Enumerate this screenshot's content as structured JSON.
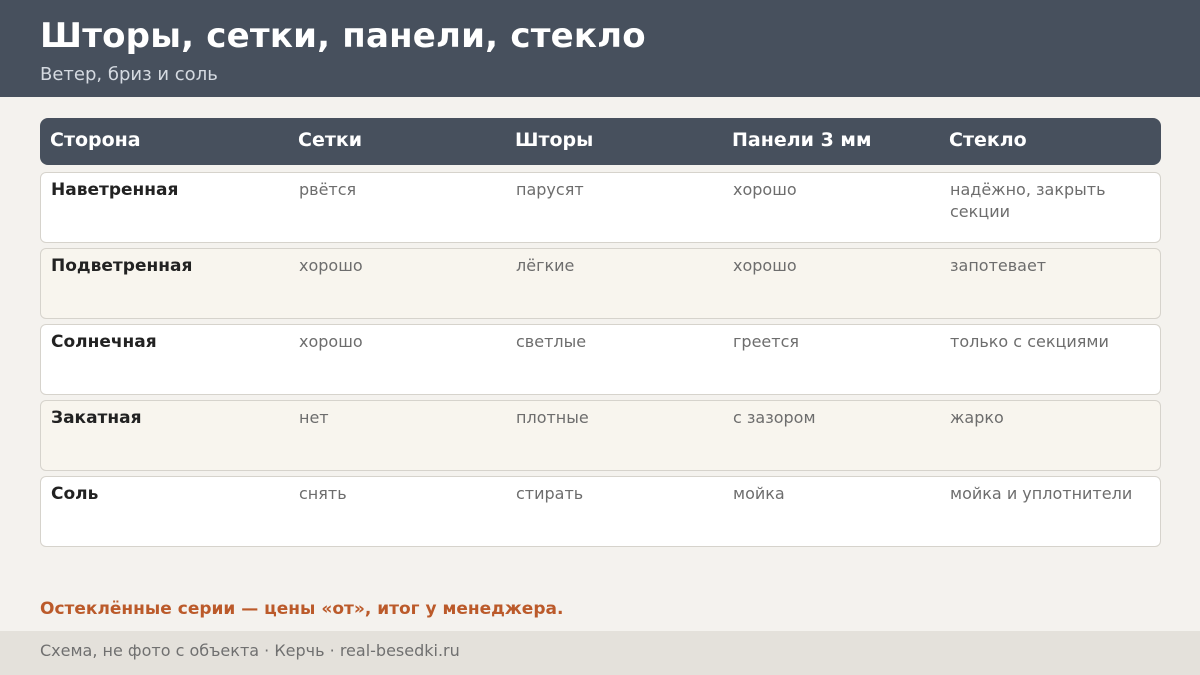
{
  "header": {
    "title": "Шторы, сетки, панели, стекло",
    "subtitle": "Ветер, бриз и соль"
  },
  "table": {
    "columns": [
      "Сторона",
      "Сетки",
      "Шторы",
      "Панели 3 мм",
      "Стекло"
    ],
    "rows": [
      [
        "Наветренная",
        "рвётся",
        "парусят",
        "хорошо",
        "надёжно, закрыть секции"
      ],
      [
        "Подветренная",
        "хорошо",
        "лёгкие",
        "хорошо",
        "запотевает"
      ],
      [
        "Солнечная",
        "хорошо",
        "светлые",
        "греется",
        "только с секциями"
      ],
      [
        "Закатная",
        "нет",
        "плотные",
        "с зазором",
        "жарко"
      ],
      [
        "Соль",
        "снять",
        "стирать",
        "мойка",
        "мойка и уплотнители"
      ]
    ]
  },
  "note": "Остеклённые серии — цены «от», итог у менеджера.",
  "footer": {
    "text": "Схема, не фото с объекта  ·  Керчь  ·  real-besedki.ru"
  },
  "colors": {
    "header_bg": "#47505d",
    "accent": "#bb5a2a",
    "page_bg": "#f4f2ee"
  }
}
